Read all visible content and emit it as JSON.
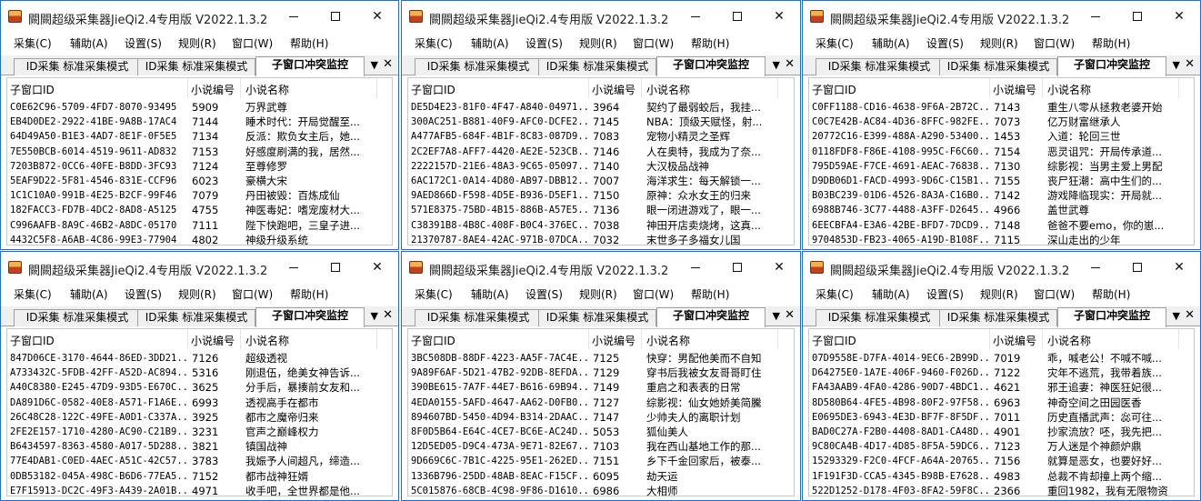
{
  "app": {
    "title": "闕闕超级采集器JieQi2.4专用版 V2022.1.3.2",
    "menu": [
      "采集(C)",
      "辅助(A)",
      "设置(S)",
      "规则(R)",
      "窗口(W)",
      "帮助(H)"
    ],
    "tabs": [
      "ID采集 标准采集模式",
      "ID采集 标准采集模式",
      "子窗口冲突监控"
    ],
    "tab_dropdown": "▼",
    "tab_close": "✕",
    "columns": [
      "子窗口ID",
      "小说编号",
      "小说名称"
    ]
  },
  "windows": [
    {
      "rows": [
        {
          "id": "C0E62C96-5709-4FD7-8070-93495",
          "num": "5909",
          "name": "万界武尊"
        },
        {
          "id": "EB4D0DE2-2922-41BE-9A8B-17AC4",
          "num": "7144",
          "name": "睡术时代：开局觉醒至..."
        },
        {
          "id": "64D49A50-B1E3-4AD7-8E1F-0F5E5",
          "num": "7134",
          "name": "反派：欺负女主后，她..."
        },
        {
          "id": "7E550BCB-6014-4519-9611-AD832",
          "num": "7153",
          "name": "好感度刷满的我，居然..."
        },
        {
          "id": "7203B872-0CC6-40FE-B8DD-3FC93",
          "num": "7124",
          "name": "至尊修罗"
        },
        {
          "id": "5EAF9D22-5F81-4546-831E-CCF96",
          "num": "6023",
          "name": "豪横大宋"
        },
        {
          "id": "1C1C10A0-991B-4E25-B2CF-99F46",
          "num": "7079",
          "name": "丹田被毁：百炼成仙"
        },
        {
          "id": "182FACC3-FD7B-4DC2-8AD8-A5125",
          "num": "4755",
          "name": "神医毒妃：嗜宠废材大..."
        },
        {
          "id": "C996AAFB-8A9C-46B2-A8DC-05170",
          "num": "7111",
          "name": "陛下快跑吧，三皇子进..."
        },
        {
          "id": "4432C5F8-A6AB-4C86-99E3-77904",
          "num": "4802",
          "name": "神级升级系统"
        }
      ]
    },
    {
      "rows": [
        {
          "id": "DE5D4E23-81F0-4F47-A840-04971...",
          "num": "3964",
          "name": "契约了最弱蛟后，我挂..."
        },
        {
          "id": "300AC251-B881-40F9-AFC0-DCFE2...",
          "num": "7145",
          "name": "NBA：顶级天赋怪，射..."
        },
        {
          "id": "A477AFB5-684F-4B1F-8C83-087D9...",
          "num": "7083",
          "name": "宠物小精灵之圣辉"
        },
        {
          "id": "2C2EF7A8-AFF7-4420-AE2E-523CB...",
          "num": "7146",
          "name": "人在奥特，我成为了奈..."
        },
        {
          "id": "2222157D-21E6-48A3-9C65-05097...",
          "num": "7140",
          "name": "大汉极品战神"
        },
        {
          "id": "6AC172C1-0A14-4D80-AB97-DBB12...",
          "num": "7007",
          "name": "海洋求生：每天解锁一..."
        },
        {
          "id": "9AED866D-F598-4D5E-B936-D5EF1...",
          "num": "7150",
          "name": "原神：众水女王的归来"
        },
        {
          "id": "571E8375-75BD-4B15-886B-A57E5...",
          "num": "7136",
          "name": "眼一闭进游戏了，眼一..."
        },
        {
          "id": "C38391B8-4B8C-408F-B0C4-376EC...",
          "num": "7038",
          "name": "神田开店卖烧烤，这真..."
        },
        {
          "id": "21370787-8AE4-42AC-971B-07DCA...",
          "num": "7032",
          "name": "末世多子多福女儿国"
        }
      ]
    },
    {
      "rows": [
        {
          "id": "C0FF1188-CD16-4638-9F6A-2B72C...",
          "num": "7143",
          "name": "重生八零从拯救老婆开始"
        },
        {
          "id": "C0C7E42B-AC84-4D36-8FFC-982FE...",
          "num": "7073",
          "name": "亿万财富继承人"
        },
        {
          "id": "20772C16-E399-488A-A290-53400...",
          "num": "1453",
          "name": "入道：轮回三世"
        },
        {
          "id": "0118FDF8-F86E-4108-995C-F6C60...",
          "num": "7154",
          "name": "恶灵诅咒：开局传承道..."
        },
        {
          "id": "795D59AE-F7CE-4691-AEAC-76838...",
          "num": "7130",
          "name": "综影视：当男主爱上男配"
        },
        {
          "id": "D9DB06D1-FACD-4993-9D6C-C15B1...",
          "num": "7155",
          "name": "丧尸狂潮：高中生们的..."
        },
        {
          "id": "B03BC239-01D6-4526-8A3A-C16B0...",
          "num": "7142",
          "name": "游戏降临现实：开局就..."
        },
        {
          "id": "6988B746-3C77-4488-A3FF-D2645...",
          "num": "4966",
          "name": "盖世武尊"
        },
        {
          "id": "6EECBFA4-E3A6-42BE-BFD7-7DCD9...",
          "num": "7148",
          "name": "爸爸不要emo，你的崽..."
        },
        {
          "id": "9704853D-FB23-4065-A19D-B108F...",
          "num": "7115",
          "name": "深山走出的少年"
        }
      ]
    },
    {
      "rows": [
        {
          "id": "847D06CE-3170-4644-86ED-3DD21...",
          "num": "7126",
          "name": "超级透视"
        },
        {
          "id": "A733432C-5FDB-42FF-A52D-AC894...",
          "num": "5316",
          "name": "刚退伍，绝美女神告诉..."
        },
        {
          "id": "A40C8380-E245-47D9-93D5-E670C...",
          "num": "3625",
          "name": "分手后，暴揍前女友和..."
        },
        {
          "id": "DA891D6C-0582-40E8-A571-F1A6E...",
          "num": "6993",
          "name": "透视高手在都市"
        },
        {
          "id": "26C48C28-122C-49FE-A0D1-C337A...",
          "num": "3925",
          "name": "都市之魔帝归来"
        },
        {
          "id": "2FE2E157-1710-4280-AC90-C21B9...",
          "num": "3231",
          "name": "官声之巅峰权力"
        },
        {
          "id": "B6434597-8363-4580-A017-5D288...",
          "num": "3821",
          "name": "镇国战神"
        },
        {
          "id": "77E4DAB1-C0ED-4AEC-A51C-42C57...",
          "num": "3783",
          "name": "我娠予人间超凡，缔造..."
        },
        {
          "id": "0DB53182-045A-498C-B6D6-77EA5...",
          "num": "7152",
          "name": "都市战神狂婿"
        },
        {
          "id": "E7F15913-DC2C-49F3-A439-2A01B...",
          "num": "4971",
          "name": "收手吧，全世界都是他..."
        }
      ]
    },
    {
      "rows": [
        {
          "id": "3BC508DB-88DF-4223-AA5F-7AC4E...",
          "num": "7125",
          "name": "快穿：男配他美而不自知"
        },
        {
          "id": "9A89F6AF-5D21-47B2-92DB-8EFDA...",
          "num": "7129",
          "name": "穿书后我被女友哥哥盯住"
        },
        {
          "id": "390BE615-7A7F-44E7-B616-69B94...",
          "num": "7149",
          "name": "重启之和表表的日常"
        },
        {
          "id": "4EDA0155-5AFD-4647-AA62-D0FB0...",
          "num": "7127",
          "name": "综影视：仙女她娇美简騰"
        },
        {
          "id": "894607BD-5450-4D94-B314-2DAAC...",
          "num": "7147",
          "name": "少帅夫人的离职计划"
        },
        {
          "id": "8F0D5B64-E64C-4CE7-BC6E-AC24D...",
          "num": "5053",
          "name": "狐仙美人"
        },
        {
          "id": "12D5ED05-D9C4-473A-9E71-82E67...",
          "num": "7103",
          "name": "我在西山基地工作的那..."
        },
        {
          "id": "9D669C6C-7B1C-4225-95E1-262ED...",
          "num": "7151",
          "name": "乡下千金回家后，被泰..."
        },
        {
          "id": "1336B796-25DD-48AB-8EAC-F15CF...",
          "num": "6095",
          "name": "劫天运"
        },
        {
          "id": "5C015876-68CB-4C98-9F86-D1610...",
          "num": "6986",
          "name": "大相师"
        }
      ]
    },
    {
      "rows": [
        {
          "id": "07D9558E-D7FA-4014-9EC6-2B99D...",
          "num": "7019",
          "name": "乖，喊老公！不喊不喊..."
        },
        {
          "id": "D64275E0-1A7E-406F-9460-F026D...",
          "num": "7122",
          "name": "灾年不逃荒，我带着族..."
        },
        {
          "id": "FA43AAB9-4FA0-4286-90D7-4BDC1...",
          "num": "4621",
          "name": "邪王追妻：神医狂妃很..."
        },
        {
          "id": "8D580B64-4FE5-4B98-80F2-97F58...",
          "num": "6963",
          "name": "神奇空间之田园医香"
        },
        {
          "id": "E0695DE3-6943-4E3D-BF7F-8F5DF...",
          "num": "7011",
          "name": "历史直播武声：惢可往..."
        },
        {
          "id": "BAD0C27A-F2B0-4408-8AD1-CA48D...",
          "num": "4901",
          "name": "抄家流放？呸，我先把..."
        },
        {
          "id": "9C80CA4B-4D17-4D85-8F5A-59DC6...",
          "num": "7123",
          "name": "万人迷是个神颜炉鼎"
        },
        {
          "id": "15293329-F2C0-4FCF-A64A-20765...",
          "num": "7156",
          "name": "就算是恶女，也要好好..."
        },
        {
          "id": "1F191F3D-CCA5-4345-B98B-E7628...",
          "num": "4983",
          "name": "总裁不肯却撞上两个缩..."
        },
        {
          "id": "522D1252-D178-4F03-8FA2-59F8C...",
          "num": "2366",
          "name": "重回1982，我有无限物资"
        }
      ]
    }
  ]
}
